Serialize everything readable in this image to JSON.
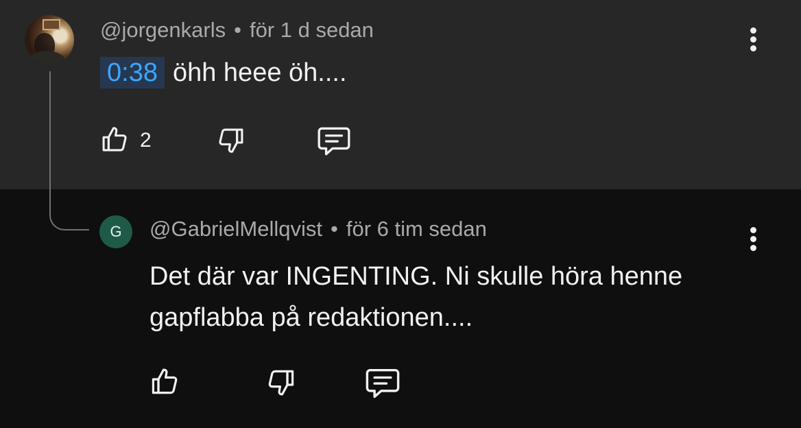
{
  "comments": [
    {
      "author": "@jorgenkarls",
      "separator": "•",
      "time": "för 1 d sedan",
      "timestamp_link": "0:38",
      "text": "öhh heee öh....",
      "like_count": "2"
    },
    {
      "author": "@GabrielMellqvist",
      "avatar_letter": "G",
      "separator": "•",
      "time": "för 6 tim sedan",
      "text_lines": [
        "Det där var INGENTING. Ni skulle höra henne",
        "gapflabba på redaktionen...."
      ]
    }
  ],
  "colors": {
    "top_bg": "#272727",
    "reply_bg": "#0f0f0f",
    "link": "#3ea6ff",
    "avatar_green": "#1f5a49"
  },
  "icons": [
    "thumb-up-icon",
    "thumb-down-icon",
    "reply-comment-icon",
    "more-vert-icon"
  ]
}
